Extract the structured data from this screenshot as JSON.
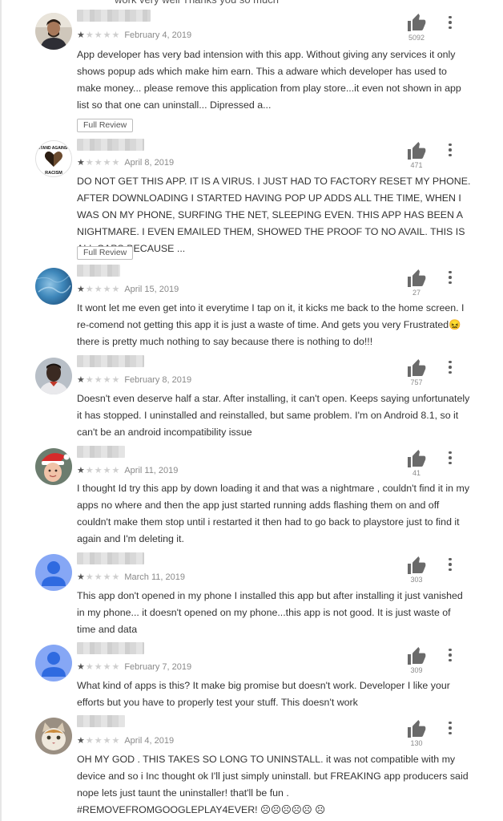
{
  "top_snippet": "work very well Thanks you so much",
  "full_review_label": "Full Review",
  "reviews": [
    {
      "date": "February 4, 2019",
      "rating": 1,
      "helpful_count": "5092",
      "text": "App developer has very bad intension with this app. Without giving any services it only shows popup ads which make him earn. This a adware which developer has used to make money... please remove this application from play store...it even not shown in app list so that one can uninstall... Dipressed a...",
      "full_review": true,
      "avatar": "photo-man"
    },
    {
      "date": "April 8, 2019",
      "rating": 1,
      "helpful_count": "471",
      "text": "DO NOT GET THIS APP. IT IS A VIRUS. I JUST HAD TO FACTORY RESET MY PHONE. AFTER DOWNLOADING I STARTED HAVING POP UP ADDS ALL THE TIME, WHEN I WAS ON MY PHONE, SURFING THE NET, SLEEPING EVEN. THIS APP HAS BEEN A NIGHTMARE. I EVEN EMAILED THEM, SHOWED THE PROOF TO NO AVAIL. THIS IS ALL CAPS BECAUSE ...",
      "full_review": true,
      "avatar": "stop-racism-logo",
      "avatar_text_top": "STAND AGAINST",
      "avatar_text_bottom": "RACISM"
    },
    {
      "date": "April 15, 2019",
      "rating": 1,
      "helpful_count": "27",
      "text": "It wont let me even get into it everytime I tap on it, it kicks me back to the home screen. I re-comend not getting this app it is just a waste of time. And gets you very Frustrated😖there is pretty much nothing to say because there is nothing to do!!!",
      "full_review": false,
      "avatar": "blue-texture"
    },
    {
      "date": "February 8, 2019",
      "rating": 1,
      "helpful_count": "757",
      "text": "Doesn't even deserve half a star. After installing, it can't open. Keeps saying unfortunately it has stopped. I uninstalled and reinstalled, but same problem. I'm on Android 8.1, so it can't be an android incompatibility issue",
      "full_review": false,
      "avatar": "photo-person"
    },
    {
      "date": "April 11, 2019",
      "rating": 1,
      "helpful_count": "41",
      "text": "I thought Id try this app by down loading it and that was a nightmare , couldn't find it in my apps no where and then the app just started running adds flashing them on and off couldn't make them stop until i restarted it then had to go back to playstore just to find it again and I'm deleting it.",
      "full_review": false,
      "avatar": "photo-santa-hat"
    },
    {
      "date": "March 11, 2019",
      "rating": 1,
      "helpful_count": "303",
      "text": "This app don't opened in my phone I installed this app but after installing it just vanished in my phone... it doesn't opened on my phone...this app is not good. It is just waste of time and data",
      "full_review": false,
      "avatar": "default-person"
    },
    {
      "date": "February 7, 2019",
      "rating": 1,
      "helpful_count": "309",
      "text": "What kind of apps is this? It make big promise but doesn't work. Developer I like your efforts but you have to properly test your stuff. This doesn't work",
      "full_review": false,
      "avatar": "default-person"
    },
    {
      "date": "April 4, 2019",
      "rating": 1,
      "helpful_count": "130",
      "text": "OH MY GOD . THIS TAKES SO LONG TO UNINSTALL. it was not compatible with my device and so i Inc thought ok I'll just simply uninstall. but FREAKING app producers said nope lets just taunt the uninstaller! that'll be fun . #REMOVEFROMGOOGLEPLAY4EVER! ☹☹☹☹☹ ☹",
      "full_review": false,
      "avatar": "photo-cat"
    }
  ],
  "colors": {
    "text": "#333333",
    "meta": "#8a8a8a",
    "star_filled": "#555555",
    "star_empty": "#cfcfcf",
    "default_avatar": "#5b8df0"
  }
}
